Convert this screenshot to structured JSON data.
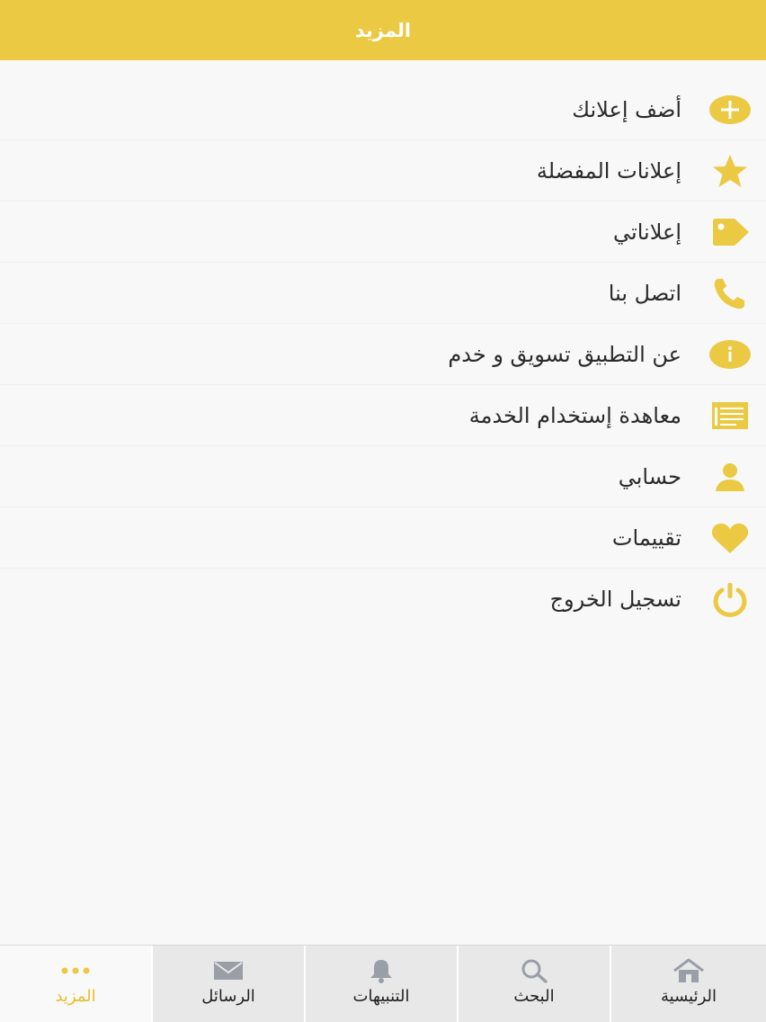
{
  "header": {
    "title": "المزيد"
  },
  "colors": {
    "accent": "#ebc943",
    "tab_active_text": "#e6bf2b",
    "tab_inactive_icon": "#9a9ea6",
    "text": "#2b2b2b"
  },
  "menu": {
    "items": [
      {
        "label": "أضف إعلانك",
        "icon": "plus-circle-icon"
      },
      {
        "label": "إعلانات المفضلة",
        "icon": "star-icon"
      },
      {
        "label": "إعلاناتي",
        "icon": "tag-icon"
      },
      {
        "label": "اتصل بنا",
        "icon": "phone-icon"
      },
      {
        "label": "عن التطبيق تسويق و خدم",
        "icon": "info-icon"
      },
      {
        "label": "معاهدة إستخدام الخدمة",
        "icon": "document-icon"
      },
      {
        "label": "حسابي",
        "icon": "user-icon"
      },
      {
        "label": "تقييمات",
        "icon": "heart-icon"
      },
      {
        "label": "تسجيل الخروج",
        "icon": "power-icon"
      }
    ]
  },
  "tabbar": {
    "items": [
      {
        "label": "المزيد",
        "icon": "more-dots-icon",
        "active": true
      },
      {
        "label": "الرسائل",
        "icon": "envelope-icon",
        "active": false
      },
      {
        "label": "التنبيهات",
        "icon": "bell-icon",
        "active": false
      },
      {
        "label": "البحث",
        "icon": "search-icon",
        "active": false
      },
      {
        "label": "الرئيسية",
        "icon": "home-icon",
        "active": false
      }
    ]
  }
}
